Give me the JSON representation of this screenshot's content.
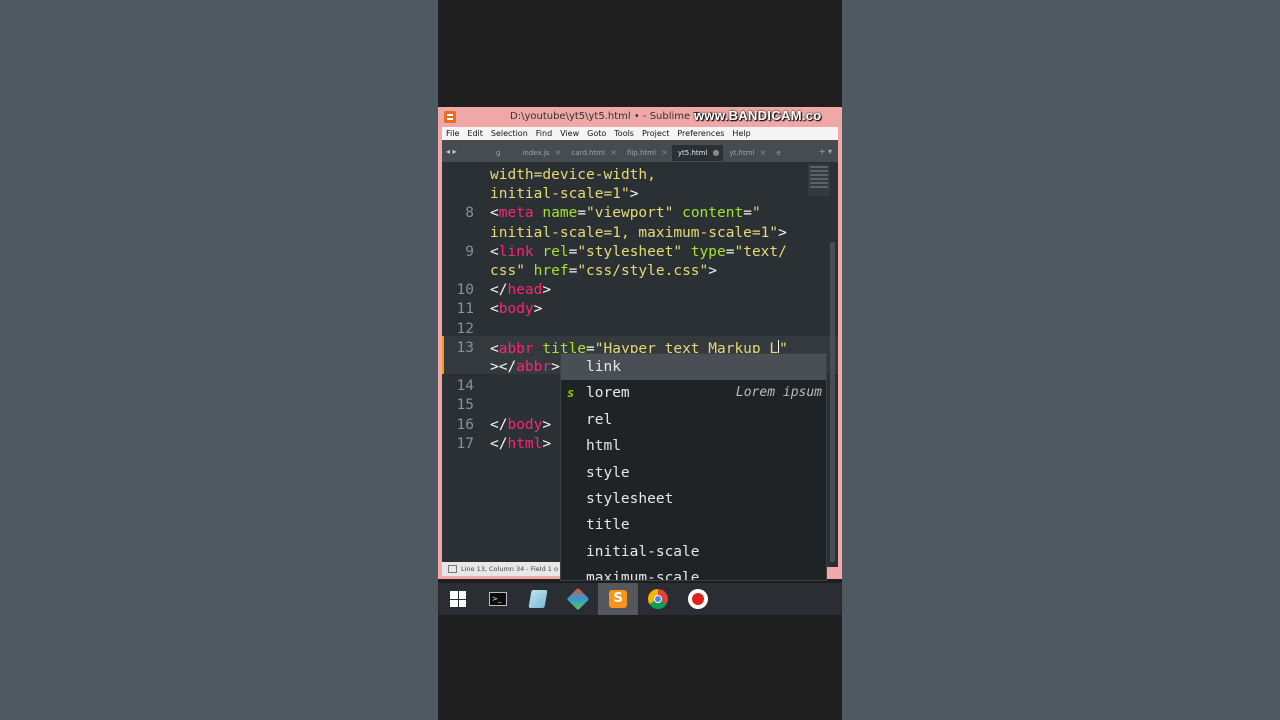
{
  "window": {
    "title": "D:\\youtube\\yt5\\yt5.html • - Sublime Text",
    "watermark": "www.BANDICAM.co"
  },
  "menu": [
    "File",
    "Edit",
    "Selection",
    "Find",
    "View",
    "Goto",
    "Tools",
    "Project",
    "Preferences",
    "Help"
  ],
  "tabs": [
    {
      "label": "g",
      "close": ""
    },
    {
      "label": "index.js",
      "close": "×"
    },
    {
      "label": "card.html",
      "close": "×"
    },
    {
      "label": "flip.html",
      "close": "×"
    },
    {
      "label": "yt5.html",
      "close": "●",
      "active": true
    },
    {
      "label": "yt.html",
      "close": "×"
    },
    {
      "label": "e",
      "close": ""
    }
  ],
  "nav_arrows": "◂ ▸",
  "tab_tools": "+ ▾",
  "editor": {
    "lines": [
      {
        "num": "",
        "segments": [
          [
            "str",
            "width=device-width,"
          ]
        ]
      },
      {
        "num": "",
        "segments": [
          [
            "str",
            "initial-scale=1\""
          ],
          [
            "punct",
            ">"
          ]
        ]
      },
      {
        "num": "8",
        "segments": [
          [
            "punct",
            "<"
          ],
          [
            "tag",
            "meta"
          ],
          [
            "punct",
            " "
          ],
          [
            "attr",
            "name"
          ],
          [
            "punct",
            "="
          ],
          [
            "str",
            "\"viewport\""
          ],
          [
            "punct",
            " "
          ],
          [
            "attr",
            "content"
          ],
          [
            "punct",
            "="
          ],
          [
            "str",
            "\""
          ]
        ]
      },
      {
        "num": "",
        "segments": [
          [
            "str",
            "initial-scale=1, maximum-scale=1\""
          ],
          [
            "punct",
            ">"
          ]
        ]
      },
      {
        "num": "9",
        "segments": [
          [
            "punct",
            "<"
          ],
          [
            "tag",
            "link"
          ],
          [
            "punct",
            " "
          ],
          [
            "attr",
            "rel"
          ],
          [
            "punct",
            "="
          ],
          [
            "str",
            "\"stylesheet\""
          ],
          [
            "punct",
            " "
          ],
          [
            "attr",
            "type"
          ],
          [
            "punct",
            "="
          ],
          [
            "str",
            "\"text/"
          ]
        ]
      },
      {
        "num": "",
        "segments": [
          [
            "str",
            "css\""
          ],
          [
            "punct",
            " "
          ],
          [
            "attr",
            "href"
          ],
          [
            "punct",
            "="
          ],
          [
            "str",
            "\"css/style.css\""
          ],
          [
            "punct",
            ">"
          ]
        ]
      },
      {
        "num": "10",
        "segments": [
          [
            "punct",
            "</"
          ],
          [
            "tag",
            "head"
          ],
          [
            "punct",
            ">"
          ]
        ]
      },
      {
        "num": "11",
        "segments": [
          [
            "punct",
            "<"
          ],
          [
            "tag",
            "body"
          ],
          [
            "punct",
            ">"
          ]
        ]
      },
      {
        "num": "12",
        "segments": []
      },
      {
        "num": "13",
        "segments": [
          [
            "punct",
            "<"
          ],
          [
            "tag",
            "abbr"
          ],
          [
            "punct",
            " "
          ],
          [
            "attr",
            "title"
          ],
          [
            "punct",
            "="
          ],
          [
            "str",
            "\"Hayper text Markup L"
          ],
          [
            "caret",
            ""
          ],
          [
            "str",
            "\""
          ]
        ]
      },
      {
        "num": "",
        "segments": [
          [
            "punct",
            "></"
          ],
          [
            "tag",
            "abbr"
          ],
          [
            "punct",
            ">"
          ]
        ]
      },
      {
        "num": "14",
        "segments": []
      },
      {
        "num": "15",
        "segments": []
      },
      {
        "num": "16",
        "segments": [
          [
            "punct",
            "</"
          ],
          [
            "tag",
            "body"
          ],
          [
            "punct",
            ">"
          ]
        ]
      },
      {
        "num": "17",
        "segments": [
          [
            "punct",
            "</"
          ],
          [
            "tag",
            "html"
          ],
          [
            "punct",
            ">"
          ]
        ]
      }
    ]
  },
  "autocomplete": [
    {
      "label": "link",
      "kind": "",
      "hint": "",
      "selected": true
    },
    {
      "label": "lorem",
      "kind": "s",
      "hint": "Lorem ipsum"
    },
    {
      "label": "rel",
      "kind": "",
      "hint": ""
    },
    {
      "label": "html",
      "kind": "",
      "hint": ""
    },
    {
      "label": "style",
      "kind": "",
      "hint": ""
    },
    {
      "label": "stylesheet",
      "kind": "",
      "hint": ""
    },
    {
      "label": "title",
      "kind": "",
      "hint": ""
    },
    {
      "label": "initial-scale",
      "kind": "",
      "hint": ""
    },
    {
      "label": "maximum-scale",
      "kind": "",
      "hint": ""
    }
  ],
  "statusbar": {
    "text": "Line 13, Column 34 - Field 1 o"
  },
  "taskbar": [
    {
      "name": "start-icon"
    },
    {
      "name": "terminal-icon"
    },
    {
      "name": "notepad-icon"
    },
    {
      "name": "git-icon"
    },
    {
      "name": "sublime-text-icon",
      "active": true
    },
    {
      "name": "chrome-icon"
    },
    {
      "name": "record-icon"
    }
  ],
  "colors": {
    "background": "#4f5962",
    "editor_bg": "#2b3034",
    "titlebar": "#f0a7a7",
    "tag": "#f92672",
    "attr": "#a6e22e",
    "string": "#e6db74"
  }
}
